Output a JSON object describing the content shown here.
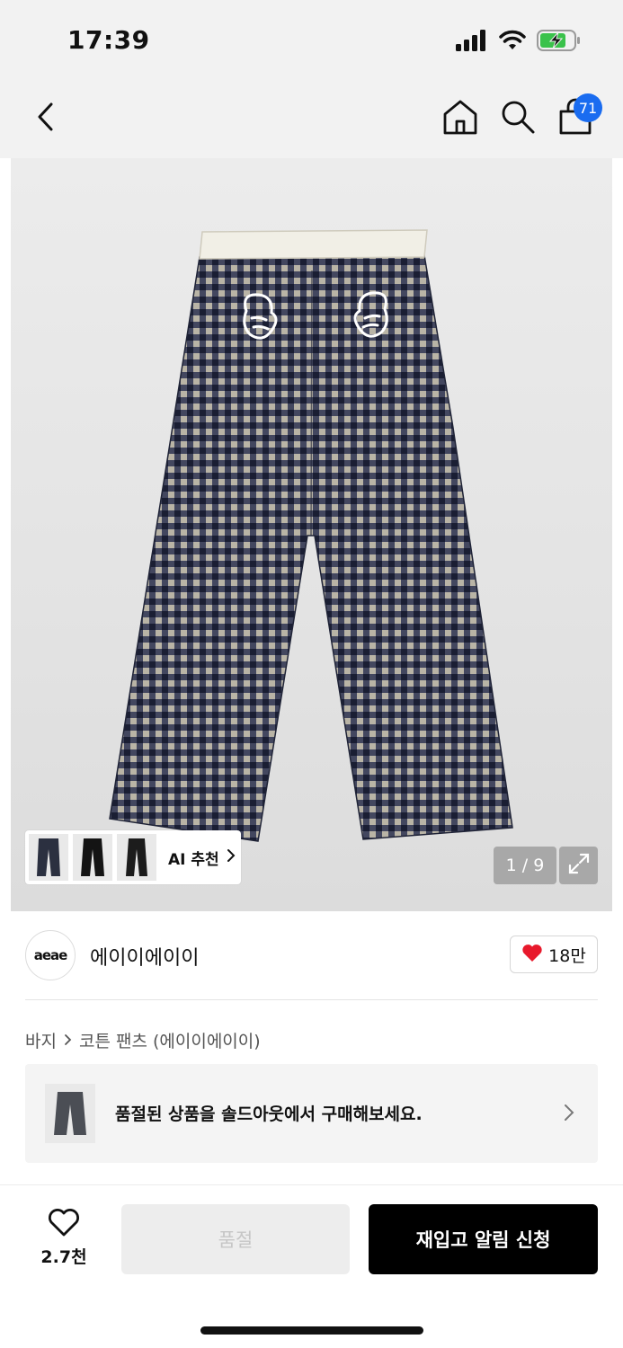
{
  "status_bar": {
    "time": "17:39",
    "icons": [
      "signal-icon",
      "wifi-icon",
      "battery-charging-icon"
    ]
  },
  "nav": {
    "icons": [
      "back-icon",
      "home-icon",
      "search-icon",
      "cart-icon"
    ],
    "cart_badge": "71"
  },
  "gallery": {
    "ai_recommend_label": "AI 추천",
    "page_indicator": "1 / 9",
    "current_page": 1,
    "total_pages": 9,
    "expand_icon": "expand-icon"
  },
  "brand": {
    "logo_text": "aeae",
    "name": "에이이에이이",
    "likes": "18만"
  },
  "breadcrumb": {
    "category": "바지",
    "product": "코튼 팬츠 (에이이에이이)"
  },
  "soldout_banner": {
    "text": "품절된 상품을 솔드아웃에서 구매해보세요."
  },
  "bottom_bar": {
    "wish_count": "2.7천",
    "soldout_label": "품절",
    "restock_label": "재입고 알림 신청"
  },
  "colors": {
    "accent_badge": "#1a6cf0",
    "heart": "#e8192c",
    "primary_button": "#000000",
    "disabled_button": "#ededed"
  }
}
